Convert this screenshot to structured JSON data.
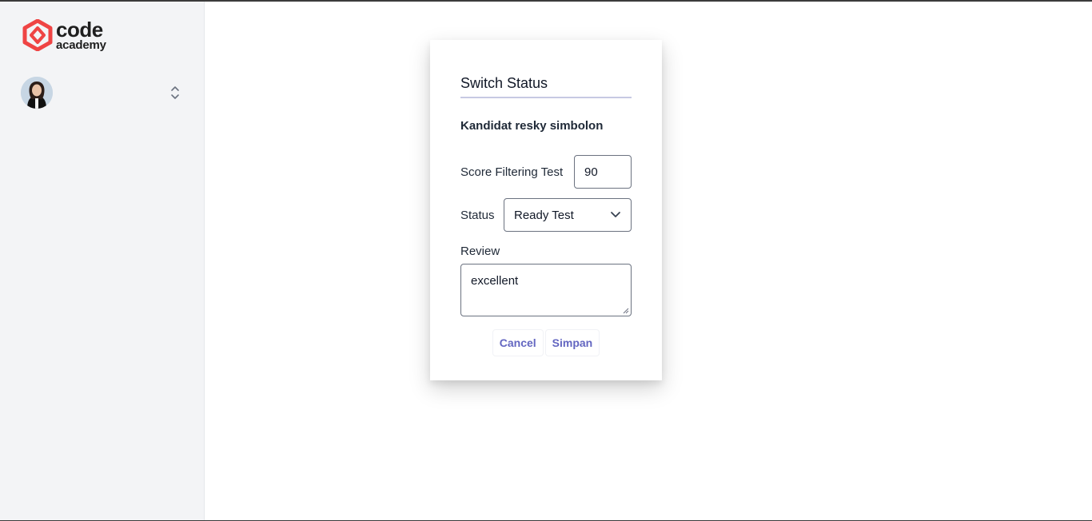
{
  "brand": {
    "line1": "code",
    "line2": "academy",
    "color": "#ef4444"
  },
  "sidebar": {
    "user_avatar": "avatar-photo",
    "selector_icon": "chevron-up-down-icon"
  },
  "modal": {
    "title": "Switch Status",
    "candidate": "Kandidat resky simbolon",
    "score_label": "Score Filtering Test",
    "score_value": "90",
    "status_label": "Status",
    "status_value": "Ready Test",
    "review_label": "Review",
    "review_value": "excellent",
    "cancel_label": "Cancel",
    "save_label": "Simpan",
    "accent": "#6366c1"
  }
}
